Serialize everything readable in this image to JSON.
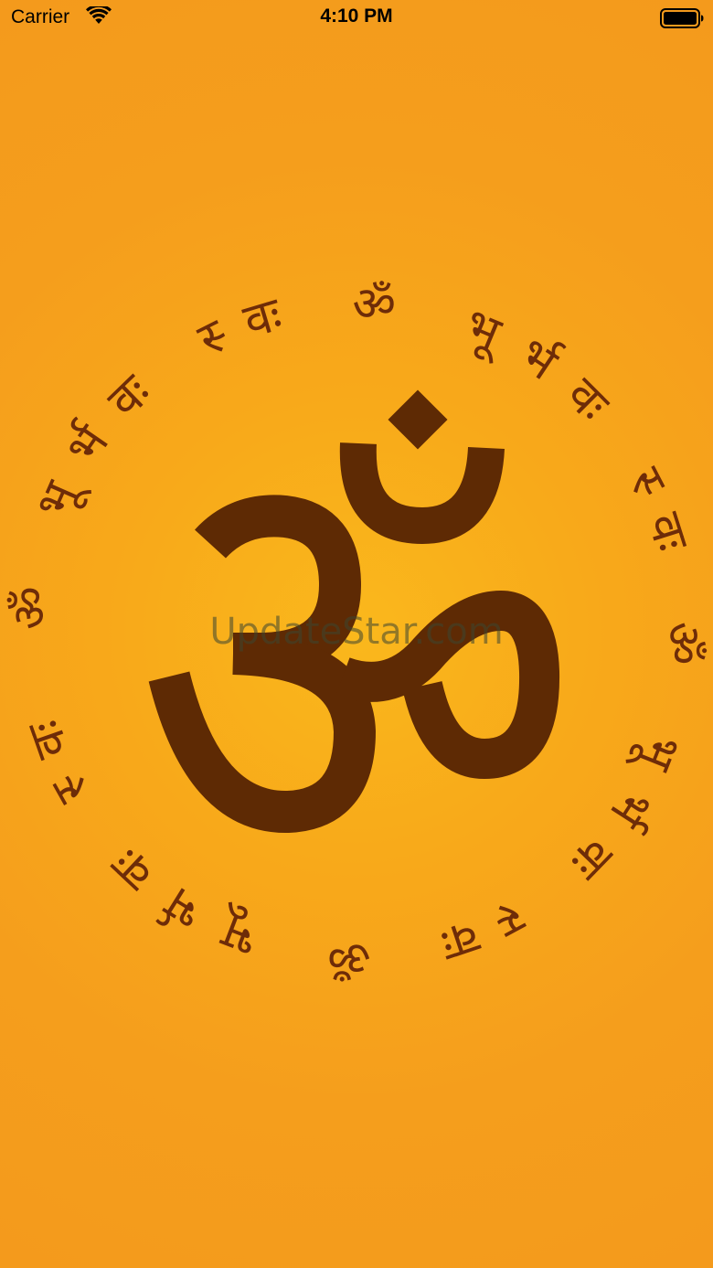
{
  "status_bar": {
    "carrier": "Carrier",
    "time": "4:10 PM",
    "wifi_icon": "wifi-icon",
    "battery_icon": "battery-full-icon"
  },
  "artwork": {
    "ring_phrase": "ॐ भूर्भवः स्वः",
    "center_symbol": "om-symbol",
    "text_color": "#6e2c08",
    "symbol_color": "#5e2a04",
    "background_color": "#f6a31b",
    "glow_color": "#fbbc1e"
  },
  "watermark": "UpdateStar.com"
}
